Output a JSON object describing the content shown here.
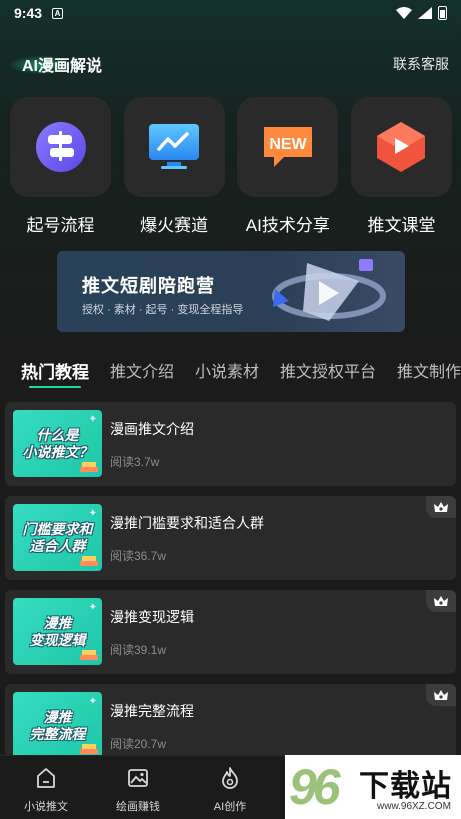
{
  "status_bar": {
    "time": "9:43",
    "notif_icon": "A"
  },
  "header": {
    "title": "AI漫画解说",
    "support": "联系客服"
  },
  "quick_actions": [
    {
      "label": "起号流程",
      "icon": "signpost-icon"
    },
    {
      "label": "爆火赛道",
      "icon": "trend-monitor-icon"
    },
    {
      "label": "AI技术分享",
      "icon": "new-badge-icon"
    },
    {
      "label": "推文课堂",
      "icon": "play-cube-icon"
    }
  ],
  "banner": {
    "title": "推文短剧陪跑营",
    "subtitle": "授权 · 素材 · 起号 · 变现全程指导"
  },
  "tabs": [
    {
      "label": "热门教程",
      "active": true
    },
    {
      "label": "推文介绍"
    },
    {
      "label": "小说素材"
    },
    {
      "label": "推文授权平台"
    },
    {
      "label": "推文制作"
    }
  ],
  "lessons": [
    {
      "thumb_text": "什么是\n小说推文？",
      "title": "漫画推文介绍",
      "reads": "阅读3.7w",
      "vip": false
    },
    {
      "thumb_text": "门槛要求和\n适合人群",
      "title": "漫推门槛要求和适合人群",
      "reads": "阅读36.7w",
      "vip": true
    },
    {
      "thumb_text": "漫推\n变现逻辑",
      "title": "漫推变现逻辑",
      "reads": "阅读39.1w",
      "vip": true
    },
    {
      "thumb_text": "漫推\n完整流程",
      "title": "漫推完整流程",
      "reads": "阅读20.7w",
      "vip": true
    }
  ],
  "bottom_nav": [
    {
      "label": "小说推文",
      "icon": "home-icon"
    },
    {
      "label": "绘画赚钱",
      "icon": "image-icon"
    },
    {
      "label": "AI创作",
      "icon": "flame-icon"
    },
    {
      "label": "",
      "icon": ""
    },
    {
      "label": "",
      "icon": ""
    }
  ],
  "watermark": {
    "number": "96",
    "text": "下载站",
    "url": "www.96XZ.COM"
  },
  "colors": {
    "accent": "#1ed99a",
    "card_bg": "#2a2a2a",
    "page_bg": "#1b1b1b",
    "thumb_bg": "#2fd6b8"
  }
}
